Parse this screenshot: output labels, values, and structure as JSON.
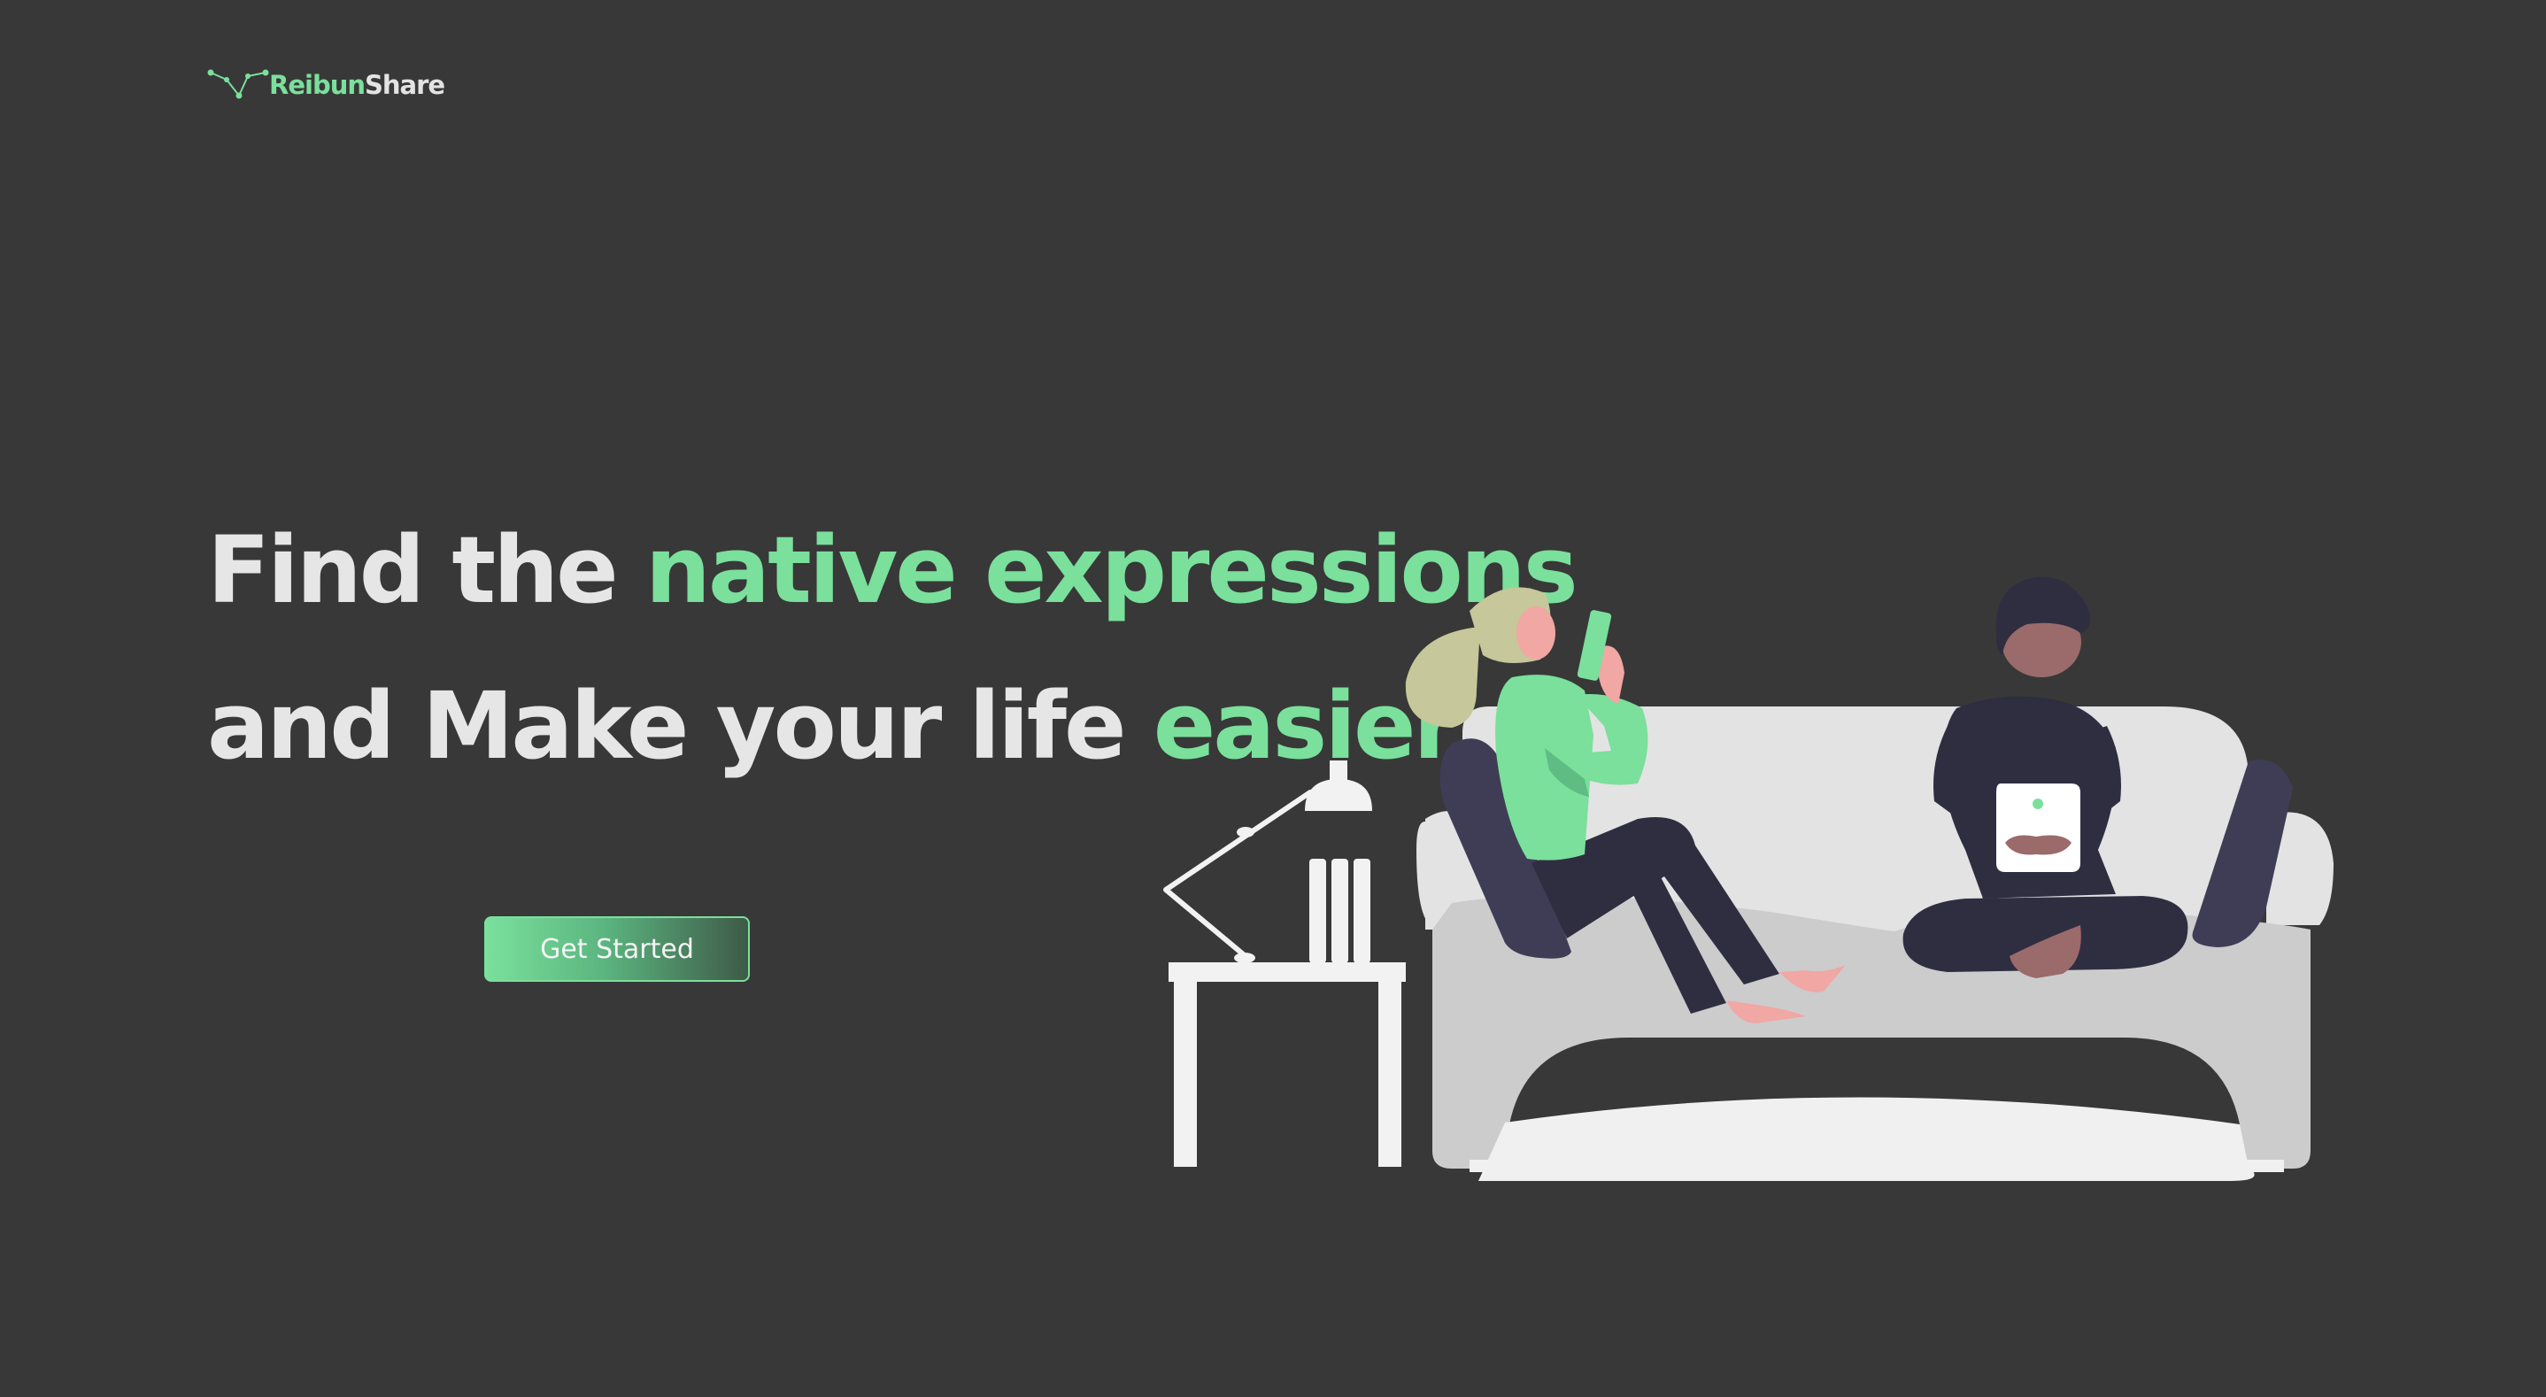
{
  "brand": {
    "name_part1": "Reibun",
    "name_part2": "Share"
  },
  "hero": {
    "line1_plain": "Find the ",
    "line1_accent": "native expressions",
    "line2_plain": "and Make your life ",
    "line2_accent": "easier"
  },
  "cta": {
    "label": "Get Started"
  },
  "colors": {
    "background": "#383838",
    "accent": "#7ae09c",
    "headline_text": "#e6e6e6",
    "sofa": "#e0e0e0",
    "dark_figure": "#2f2e41"
  },
  "icons": {
    "logo_mark": "constellation-icon"
  }
}
